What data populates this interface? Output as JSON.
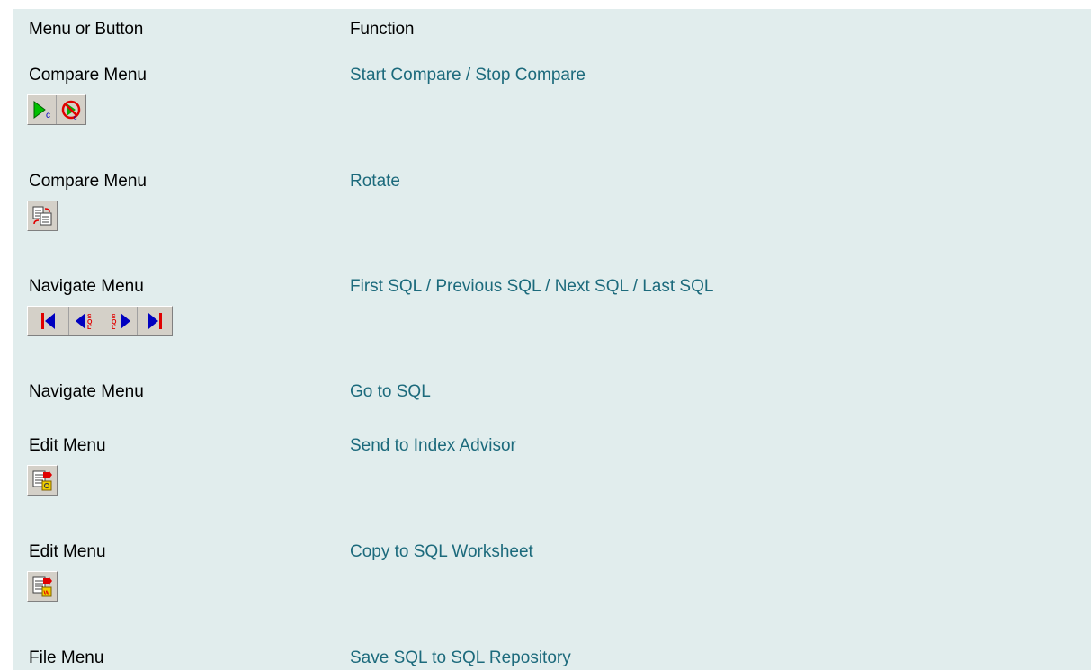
{
  "table": {
    "header": {
      "menu": "Menu or Button",
      "function": "Function"
    },
    "rows": [
      {
        "menu": "Compare Menu",
        "function": "Start Compare / Stop Compare",
        "icons": [
          "start-compare-icon",
          "stop-compare-icon"
        ]
      },
      {
        "menu": "Compare Menu",
        "function": "Rotate",
        "icons": [
          "rotate-icon"
        ]
      },
      {
        "menu": "Navigate Menu",
        "function": "First SQL / Previous SQL / Next SQL / Last SQL",
        "icons": [
          "first-sql-icon",
          "previous-sql-icon",
          "next-sql-icon",
          "last-sql-icon"
        ]
      },
      {
        "menu": "Navigate Menu",
        "function": "Go to SQL",
        "icons": []
      },
      {
        "menu": "Edit Menu",
        "function": "Send to Index Advisor",
        "icons": [
          "index-advisor-icon"
        ]
      },
      {
        "menu": "Edit Menu",
        "function": "Copy to SQL Worksheet",
        "icons": [
          "sql-worksheet-icon"
        ]
      },
      {
        "menu": "File Menu",
        "function": "Save SQL to SQL Repository",
        "icons": []
      }
    ]
  },
  "colors": {
    "panel_bg": "#e1eded",
    "link": "#1c6a7c",
    "text": "#000000",
    "button_face": "#d4d0c8"
  }
}
